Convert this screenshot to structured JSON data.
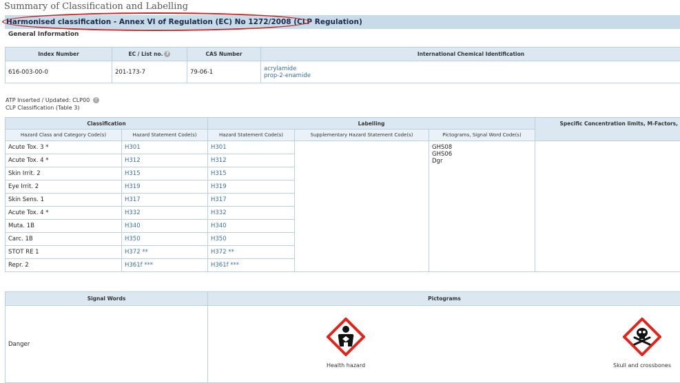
{
  "summary_title": "Summary of Classification and Labelling",
  "section_title": "Harmonised classification - Annex VI of Regulation (EC) No 1272/2008 (CLP Regulation)",
  "general_info": "General Information",
  "general_table": {
    "headers": [
      "Index Number",
      "EC / List no.",
      "CAS Number",
      "International Chemical Identification"
    ],
    "row": {
      "index": "616-003-00-0",
      "ec": "201-173-7",
      "cas": "79-06-1",
      "names": [
        "acrylamide",
        "prop-2-enamide"
      ]
    }
  },
  "atp_label": "ATP Inserted / Updated: CLP00",
  "clp_label": "CLP Classification (Table 3)",
  "class_table": {
    "group_headers": [
      "Classification",
      "Labelling",
      "Specific Concentration limits, M-Factors,"
    ],
    "sub_headers": [
      "Hazard Class and Category Code(s)",
      "Hazard Statement Code(s)",
      "Hazard Statement Code(s)",
      "Supplementary Hazard Statement Code(s)",
      "Pictograms, Signal Word Code(s)"
    ],
    "rows": [
      {
        "cls": "Acute Tox. 3 *",
        "hs1": "H301",
        "hs2": "H301"
      },
      {
        "cls": "Acute Tox. 4 *",
        "hs1": "H312",
        "hs2": "H312"
      },
      {
        "cls": "Skin Irrit. 2",
        "hs1": "H315",
        "hs2": "H315"
      },
      {
        "cls": "Eye Irrit. 2",
        "hs1": "H319",
        "hs2": "H319"
      },
      {
        "cls": "Skin Sens. 1",
        "hs1": "H317",
        "hs2": "H317"
      },
      {
        "cls": "Acute Tox. 4 *",
        "hs1": "H332",
        "hs2": "H332"
      },
      {
        "cls": "Muta. 1B",
        "hs1": "H340",
        "hs2": "H340"
      },
      {
        "cls": "Carc. 1B",
        "hs1": "H350",
        "hs2": "H350"
      },
      {
        "cls": "STOT RE 1",
        "hs1": "H372 **",
        "hs2": "H372 **"
      },
      {
        "cls": "Repr. 2",
        "hs1": "H361f ***",
        "hs2": "H361f ***"
      }
    ],
    "pictogram_codes": [
      "GHS08",
      "GHS06",
      "Dgr"
    ]
  },
  "signal_table": {
    "headers": [
      "Signal Words",
      "Pictograms"
    ],
    "signal_word": "Danger",
    "pictograms": [
      {
        "label": "Health hazard",
        "icon": "health-hazard-icon"
      },
      {
        "label": "Skull and crossbones",
        "icon": "skull-crossbones-icon"
      }
    ]
  },
  "colors": {
    "link": "#3a6fa8",
    "header_bg": "#dbe8f2",
    "section_bg": "#c7dbe9",
    "highlight_oval": "#cc2222",
    "pictogram_border": "#e2231a"
  }
}
